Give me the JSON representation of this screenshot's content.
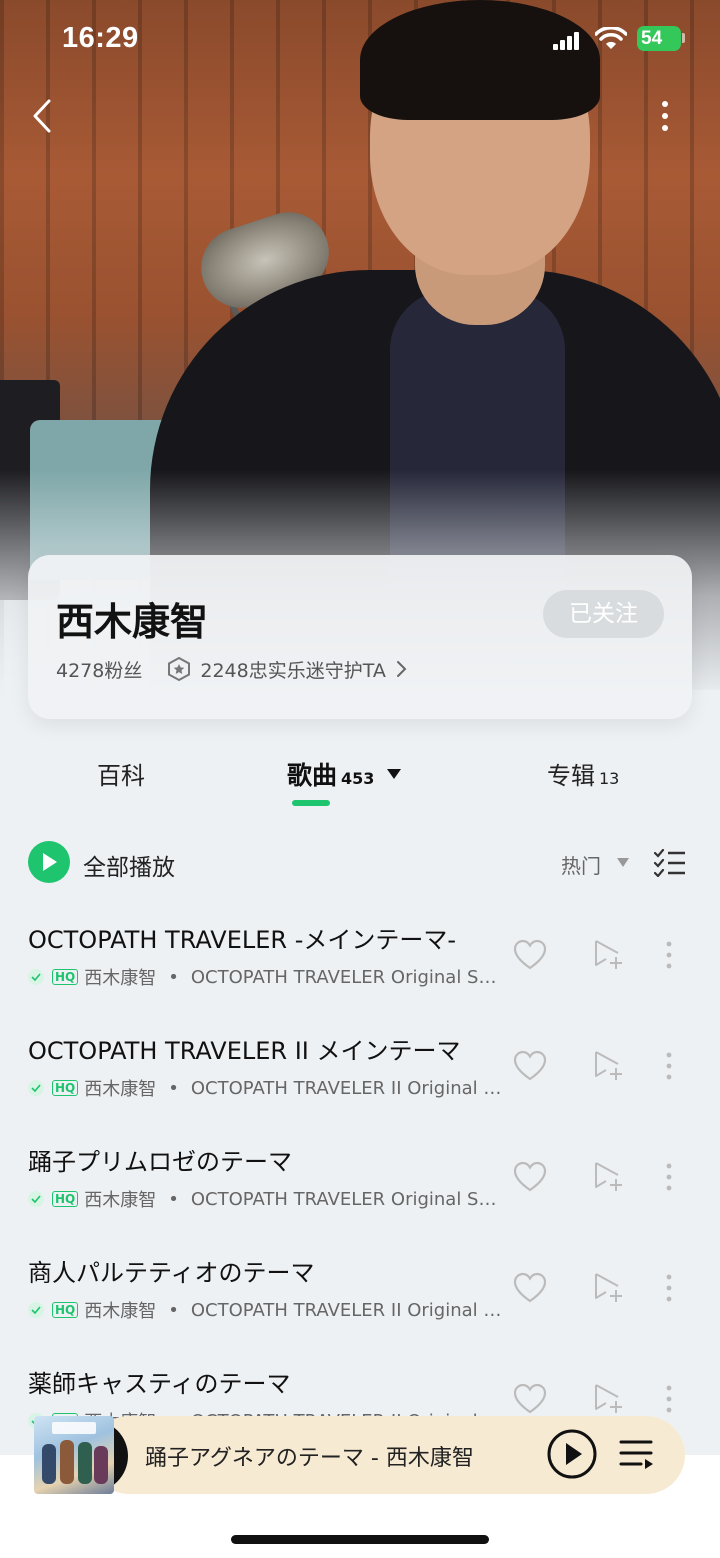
{
  "status_bar": {
    "time": "16:29",
    "battery": "54"
  },
  "artist": {
    "name": "西木康智",
    "follow_label": "已关注",
    "fans": "4278粉丝",
    "guard_text": "2248忠实乐迷守护TA"
  },
  "tabs": [
    {
      "label": "百科",
      "count": ""
    },
    {
      "label": "歌曲",
      "count": "453"
    },
    {
      "label": "专辑",
      "count": "13"
    }
  ],
  "playall": {
    "label": "全部播放",
    "sort_label": "热门"
  },
  "songs": [
    {
      "title": "OCTOPATH TRAVELER -メインテーマ-",
      "quality": "HQ",
      "artist": "西木康智",
      "album": "OCTOPATH TRAVELER Original Soundtrack"
    },
    {
      "title": "OCTOPATH TRAVELER II メインテーマ",
      "quality": "HQ",
      "artist": "西木康智",
      "album": "OCTOPATH TRAVELER II Original Soundtrack"
    },
    {
      "title": "踊子プリムロゼのテーマ",
      "quality": "HQ",
      "artist": "西木康智",
      "album": "OCTOPATH TRAVELER Original Soundtrack"
    },
    {
      "title": "商人パルテティオのテーマ",
      "quality": "HQ",
      "artist": "西木康智",
      "album": "OCTOPATH TRAVELER II Original Soundtrack"
    },
    {
      "title": "薬師キャスティのテーマ",
      "quality": "HQ",
      "artist": "西木康智",
      "album": "OCTOPATH TRAVELER II Original Soundtrack"
    }
  ],
  "mini_player": {
    "now_playing": "踊子アグネアのテーマ - 西木康智"
  },
  "colors": {
    "accent": "#1ec46e",
    "mini_player_bg": "#f7ead2"
  },
  "icons": {
    "back": "chevron-left-icon",
    "more": "more-vertical-icon",
    "guard": "star-badge-icon",
    "like": "heart-outline-icon",
    "add_to_playlist": "add-to-playlist-icon",
    "multi_select": "checklist-icon",
    "play": "play-icon",
    "queue": "playlist-queue-icon"
  }
}
